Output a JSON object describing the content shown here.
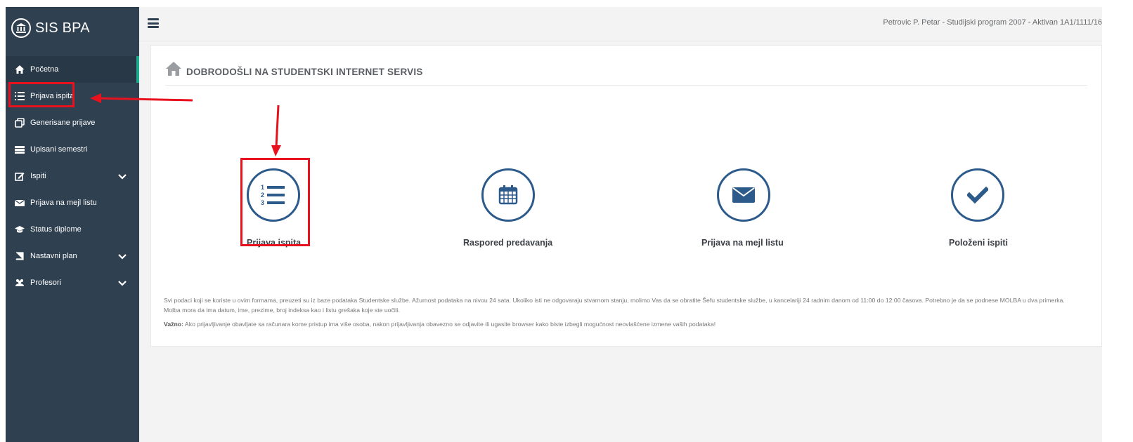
{
  "app": {
    "brand": "SIS BPA",
    "user_info": "Petrovic P. Petar - Studijski program 2007 - Aktivan 1A1/1111/16"
  },
  "sidebar": {
    "items": [
      {
        "label": "Početna",
        "icon": "home-icon"
      },
      {
        "label": "Prijava ispita",
        "icon": "list-ordered-icon"
      },
      {
        "label": "Generisane prijave",
        "icon": "copy-icon"
      },
      {
        "label": "Upisani semestri",
        "icon": "storage-icon"
      },
      {
        "label": "Ispiti",
        "icon": "edit-icon",
        "expandable": true
      },
      {
        "label": "Prijava na mejl listu",
        "icon": "envelope-icon"
      },
      {
        "label": "Status diplome",
        "icon": "graduation-cap-icon"
      },
      {
        "label": "Nastavni plan",
        "icon": "book-icon",
        "expandable": true
      },
      {
        "label": "Profesori",
        "icon": "users-icon",
        "expandable": true
      }
    ]
  },
  "main": {
    "title": "DOBRODOŠLI NA STUDENTSKI INTERNET SERVIS",
    "tiles": [
      {
        "label": "Prijava ispita",
        "icon": "list-ordered-icon"
      },
      {
        "label": "Raspored predavanja",
        "icon": "calendar-icon"
      },
      {
        "label": "Prijava na mejl listu",
        "icon": "envelope-icon"
      },
      {
        "label": "Položeni ispiti",
        "icon": "check-icon"
      }
    ],
    "info_text": "Svi podaci koji se koriste u ovim formama, preuzeti su iz baze podataka Studentske službe. Ažurnost podataka na nivou 24 sata. Ukoliko isti ne odgovaraju stvarnom stanju, molimo Vas da se obratite Šefu studentske službe, u kancelariji 24 radnim danom od 11:00 do 12:00 časova. Potrebno je da se podnese MOLBA u dva primerka. Molba mora da ima datum, ime, prezime, broj indeksa kao i listu grešaka koje ste uočili.",
    "warning_label": "Važno:",
    "warning_text": " Ako prijavljivanje obavljate sa računara kome pristup ima više osoba, nakon prijavljivanja obavezno se odjavite ili ugasite browser kako biste izbegli mogućnost neovlašćene izmene vaših podataka!"
  },
  "colors": {
    "sidebar_bg": "#2f4050",
    "accent": "#19aa8d",
    "icon_blue": "#2c5a8a",
    "annotation_red": "#e8121f"
  }
}
